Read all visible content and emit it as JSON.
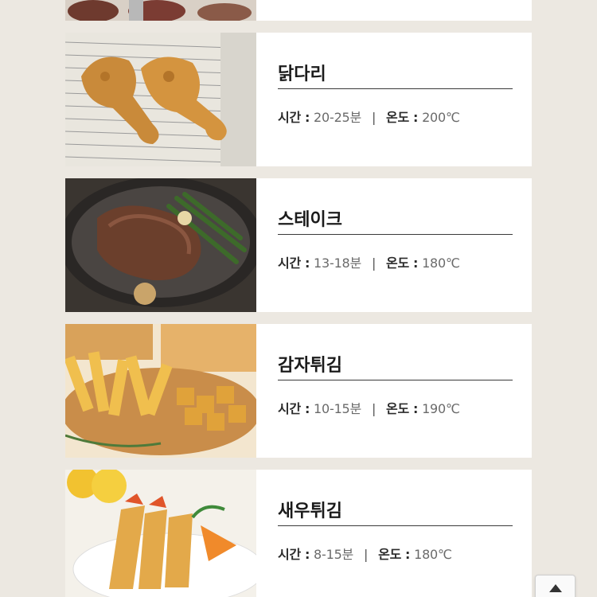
{
  "foods": [
    {
      "name": "",
      "time_label": "",
      "time": "",
      "temp_label": "",
      "temp": ""
    },
    {
      "name": "닭다리",
      "time_label": "시간",
      "time": "20-25분",
      "temp_label": "온도",
      "temp": "200℃",
      "image": "fried-chicken-drumsticks"
    },
    {
      "name": "스테이크",
      "time_label": "시간",
      "time": "13-18분",
      "temp_label": "온도",
      "temp": "180℃",
      "image": "steak-in-pan"
    },
    {
      "name": "감자튀김",
      "time_label": "시간",
      "time": "10-15분",
      "temp_label": "온도",
      "temp": "190℃",
      "image": "french-fries"
    },
    {
      "name": "새우튀김",
      "time_label": "시간",
      "time": "8-15분",
      "temp_label": "온도",
      "temp": "180℃",
      "image": "fried-shrimp"
    }
  ],
  "separator": "|",
  "colon": ":",
  "icons": {
    "scroll_top": "triangle-up-icon"
  }
}
